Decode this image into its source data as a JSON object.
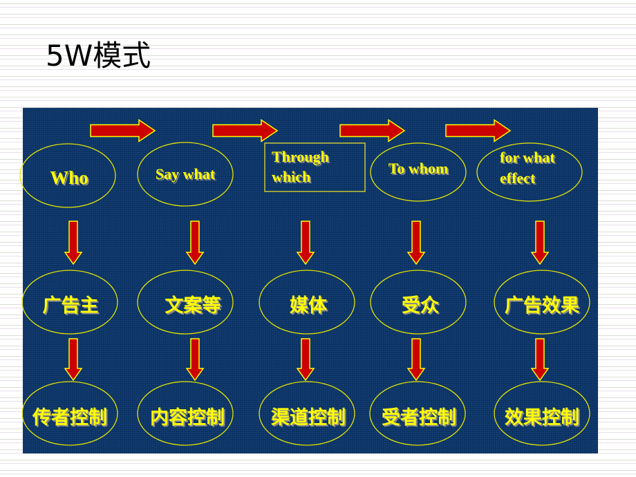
{
  "title": "5W模式",
  "colors": {
    "panel": "#0b3264",
    "text": "#ffff00",
    "arrow_fill": "#cc0000",
    "arrow_outline": "#ffff00",
    "ellipse_outline": "#e6e600"
  },
  "diagram": {
    "flow_direction": "left-to-right across top row, top-to-bottom down each column",
    "top_row": [
      {
        "label": "Who",
        "shape": "ellipse"
      },
      {
        "label": "Say what",
        "shape": "ellipse"
      },
      {
        "label_line1": "Through",
        "label_line2": "which",
        "shape": "rectangle"
      },
      {
        "label": "To whom",
        "shape": "ellipse"
      },
      {
        "label_line1": "for what",
        "label_line2": "effect",
        "shape": "ellipse"
      }
    ],
    "middle_row": [
      {
        "label": "广告主"
      },
      {
        "label": "文案等"
      },
      {
        "label": "媒体"
      },
      {
        "label": "受众"
      },
      {
        "label": "广告效果"
      }
    ],
    "bottom_row": [
      {
        "label": "传者控制"
      },
      {
        "label": "内容控制"
      },
      {
        "label": "渠道控制"
      },
      {
        "label": "受者控制"
      },
      {
        "label": "效果控制"
      }
    ],
    "connectors": {
      "horizontal_arrows": 4,
      "vertical_arrows_per_column": 2,
      "icon": "arrow-icon"
    }
  }
}
